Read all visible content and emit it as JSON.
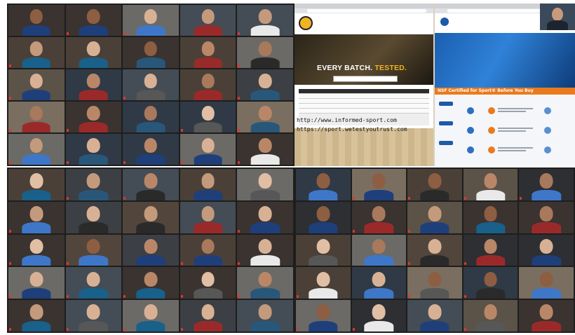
{
  "meeting": {
    "share": {
      "left_window": {
        "hero_lead": "EVERY BATCH.",
        "hero_accent": "TESTED.",
        "url_1": "http://www.informed-sport.com",
        "url_2": "https://sport.wetestyoutrust.com"
      },
      "right_window": {
        "banner": "NSF Certified for Sport®  Before You Buy"
      }
    },
    "colors": {
      "gallery_bg": "#1e1e1e",
      "active_speaker": "#b8d84a",
      "muted": "#e0362c",
      "accent_gold": "#f0b323",
      "nsf_orange": "#e97a1f",
      "nsf_blue": "#1d5aa8"
    },
    "icons": [
      "muted-mic-icon"
    ],
    "galleries": [
      {
        "name": "gallery-top-left",
        "cols": 5,
        "rows": 5,
        "participant_count": 25
      },
      {
        "name": "gallery-bottom-left",
        "cols": 5,
        "rows": 5,
        "participant_count": 25
      },
      {
        "name": "gallery-bottom-right",
        "cols": 5,
        "rows": 5,
        "participant_count": 25
      }
    ]
  }
}
